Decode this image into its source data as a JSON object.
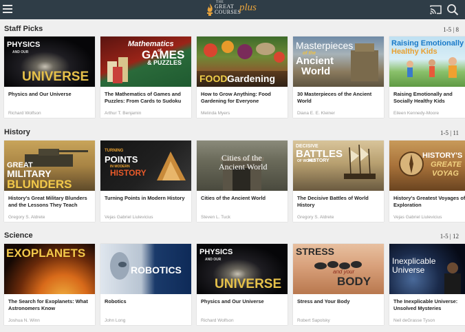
{
  "header": {
    "logo_the": "THE",
    "logo_great": "GREAT",
    "logo_courses": "COURSES",
    "logo_plus": "plus",
    "menu_icon": "hamburger-menu-icon",
    "cast_icon": "cast-icon",
    "search_icon": "search-icon"
  },
  "sections": [
    {
      "title": "Staff Picks",
      "count": "1-5 | 8",
      "cards": [
        {
          "title": "Physics and Our Universe",
          "author": "Richard Wolfson",
          "thumb_lines": [
            "PHYSICS",
            "AND OUR",
            "UNIVERSE"
          ]
        },
        {
          "title": "The Mathematics of Games and Puzzles: From Cards to Sudoku",
          "author": "Arthur T. Benjamin",
          "thumb_lines": [
            "Mathematics",
            "of",
            "GAMES",
            "& PUZZLES"
          ]
        },
        {
          "title": "How to Grow Anything: Food Gardening for Everyone",
          "author": "Melinda Myers",
          "thumb_lines": [
            "FOOD",
            "Gardening"
          ]
        },
        {
          "title": "30 Masterpieces of the Ancient World",
          "author": "Diana E. E. Kleiner",
          "thumb_lines": [
            "Masterpieces",
            "of the",
            "Ancient",
            "World"
          ]
        },
        {
          "title": "Raising Emotionally and Socially Healthy Kids",
          "author": "Eileen Kennedy-Moore",
          "thumb_lines": [
            "Raising Emotionally",
            "Healthy Kids"
          ]
        }
      ]
    },
    {
      "title": "History",
      "count": "1-5 | 11",
      "cards": [
        {
          "title": "History's Great Military Blunders and the Lessons They Teach",
          "author": "Gregory S. Aldrete",
          "thumb_lines": [
            "GREAT",
            "MILITARY",
            "BLUNDERS"
          ]
        },
        {
          "title": "Turning Points in Modern History",
          "author": "Vejas Gabriel Liulevicius",
          "thumb_lines": [
            "TURNING",
            "POINTS",
            "IN MODERN",
            "HISTORY"
          ]
        },
        {
          "title": "Cities of the Ancient World",
          "author": "Steven L. Tuck",
          "thumb_lines": [
            "Cities of the",
            "Ancient World"
          ]
        },
        {
          "title": "The Decisive Battles of World History",
          "author": "Gregory S. Aldrete",
          "thumb_lines": [
            "DECISIVE",
            "BATTLES",
            "OF WORLD",
            "HISTORY"
          ]
        },
        {
          "title": "History's Greatest Voyages of Exploration",
          "author": "Vejas Gabriel Liulevicius",
          "thumb_lines": [
            "HISTORY'S",
            "GREATE",
            "VOYAG"
          ]
        }
      ]
    },
    {
      "title": "Science",
      "count": "1-5 | 12",
      "cards": [
        {
          "title": "The Search for Exoplanets: What Astronomers Know",
          "author": "Joshua N. Winn",
          "thumb_lines": [
            "EXOPLANETS"
          ]
        },
        {
          "title": "Robotics",
          "author": "John Long",
          "thumb_lines": [
            "ROBOTICS"
          ]
        },
        {
          "title": "Physics and Our Universe",
          "author": "Richard Wolfson",
          "thumb_lines": [
            "PHYSICS",
            "AND OUR",
            "UNIVERSE"
          ]
        },
        {
          "title": "Stress and Your Body",
          "author": "Robert Sapolsky",
          "thumb_lines": [
            "STRESS",
            "and your",
            "BODY"
          ]
        },
        {
          "title": "The Inexplicable Universe: Unsolved Mysteries",
          "author": "Neil deGrasse Tyson",
          "thumb_lines": [
            "Inexplicable",
            "Universe"
          ]
        }
      ]
    }
  ]
}
